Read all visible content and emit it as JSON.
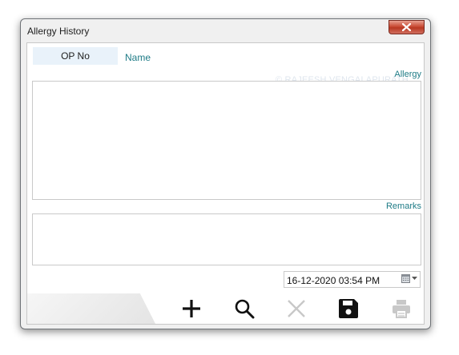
{
  "window": {
    "title": "Allergy History"
  },
  "form": {
    "op_no_label": "OP No",
    "name_label": "Name",
    "watermark": "© RAJEESH VENGALAPURATH",
    "allergy_label": "Allergy",
    "allergy_value": "",
    "remarks_label": "Remarks",
    "remarks_value": "",
    "datetime_value": "16-12-2020 03:54 PM"
  },
  "toolbar": {
    "buttons": [
      {
        "icon": "plus-icon",
        "enabled": true
      },
      {
        "icon": "search-icon",
        "enabled": true
      },
      {
        "icon": "close-icon",
        "enabled": false
      },
      {
        "icon": "save-icon",
        "enabled": true
      },
      {
        "icon": "print-icon",
        "enabled": false
      }
    ]
  },
  "colors": {
    "label_teal": "#1e7b86",
    "close_red": "#c94b35",
    "disabled_gray": "#c8c8c8"
  }
}
